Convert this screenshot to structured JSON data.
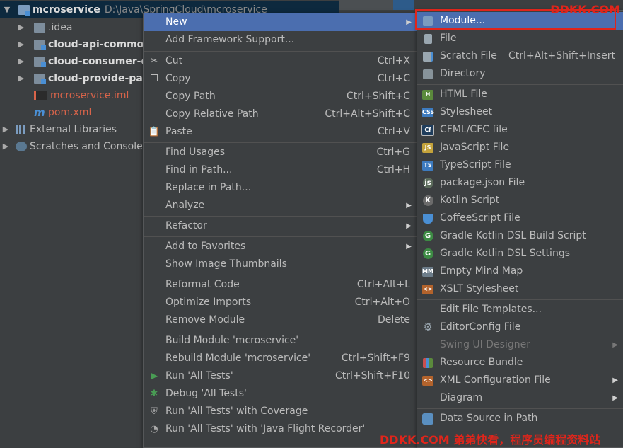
{
  "tree": {
    "root": {
      "name": "mcroservice",
      "path": "D:\\Java\\SpringCloud\\mcroservice"
    },
    "items": [
      {
        "label": ".idea"
      },
      {
        "label": "cloud-api-common"
      },
      {
        "label": "cloud-consumer-or"
      },
      {
        "label": "cloud-provide-payi"
      },
      {
        "label": "mcroservice.iml"
      },
      {
        "label": "pom.xml"
      },
      {
        "label": "External Libraries"
      },
      {
        "label": "Scratches and Consoles"
      }
    ]
  },
  "menu1": [
    {
      "label": "New",
      "sub": "▶"
    },
    {
      "label": "Add Framework Support..."
    },
    {
      "label": "Cut",
      "shortcut": "Ctrl+X"
    },
    {
      "label": "Copy",
      "shortcut": "Ctrl+C"
    },
    {
      "label": "Copy Path",
      "shortcut": "Ctrl+Shift+C"
    },
    {
      "label": "Copy Relative Path",
      "shortcut": "Ctrl+Alt+Shift+C"
    },
    {
      "label": "Paste",
      "shortcut": "Ctrl+V"
    },
    {
      "label": "Find Usages",
      "shortcut": "Ctrl+G"
    },
    {
      "label": "Find in Path...",
      "shortcut": "Ctrl+H"
    },
    {
      "label": "Replace in Path..."
    },
    {
      "label": "Analyze",
      "sub": "▶"
    },
    {
      "label": "Refactor",
      "sub": "▶"
    },
    {
      "label": "Add to Favorites",
      "sub": "▶"
    },
    {
      "label": "Show Image Thumbnails"
    },
    {
      "label": "Reformat Code",
      "shortcut": "Ctrl+Alt+L"
    },
    {
      "label": "Optimize Imports",
      "shortcut": "Ctrl+Alt+O"
    },
    {
      "label": "Remove Module",
      "shortcut": "Delete"
    },
    {
      "label": "Build Module 'mcroservice'"
    },
    {
      "label": "Rebuild Module 'mcroservice'",
      "shortcut": "Ctrl+Shift+F9"
    },
    {
      "label": "Run 'All Tests'",
      "shortcut": "Ctrl+Shift+F10"
    },
    {
      "label": "Debug 'All Tests'"
    },
    {
      "label": "Run 'All Tests' with Coverage"
    },
    {
      "label": "Run 'All Tests' with 'Java Flight Recorder'"
    }
  ],
  "menu2": [
    {
      "label": "Module..."
    },
    {
      "label": "File"
    },
    {
      "label": "Scratch File",
      "shortcut": "Ctrl+Alt+Shift+Insert"
    },
    {
      "label": "Directory"
    },
    {
      "label": "HTML File"
    },
    {
      "label": "Stylesheet"
    },
    {
      "label": "CFML/CFC file"
    },
    {
      "label": "JavaScript File"
    },
    {
      "label": "TypeScript File"
    },
    {
      "label": "package.json File"
    },
    {
      "label": "Kotlin Script"
    },
    {
      "label": "CoffeeScript File"
    },
    {
      "label": "Gradle Kotlin DSL Build Script"
    },
    {
      "label": "Gradle Kotlin DSL Settings"
    },
    {
      "label": "Empty Mind Map"
    },
    {
      "label": "XSLT Stylesheet"
    },
    {
      "label": "Edit File Templates..."
    },
    {
      "label": "EditorConfig File"
    },
    {
      "label": "Swing UI Designer",
      "sub": "▶"
    },
    {
      "label": "Resource Bundle"
    },
    {
      "label": "XML Configuration File",
      "sub": "▶"
    },
    {
      "label": "Diagram",
      "sub": "▶"
    },
    {
      "label": "Data Source in Path"
    }
  ],
  "watermark": {
    "top": "DDKK.COM",
    "bottom": "DDKK.COM 弟弟快看，程序员编程资料站"
  },
  "colors": {
    "highlight": "#4b6eaf",
    "annotation": "#e0251b"
  }
}
